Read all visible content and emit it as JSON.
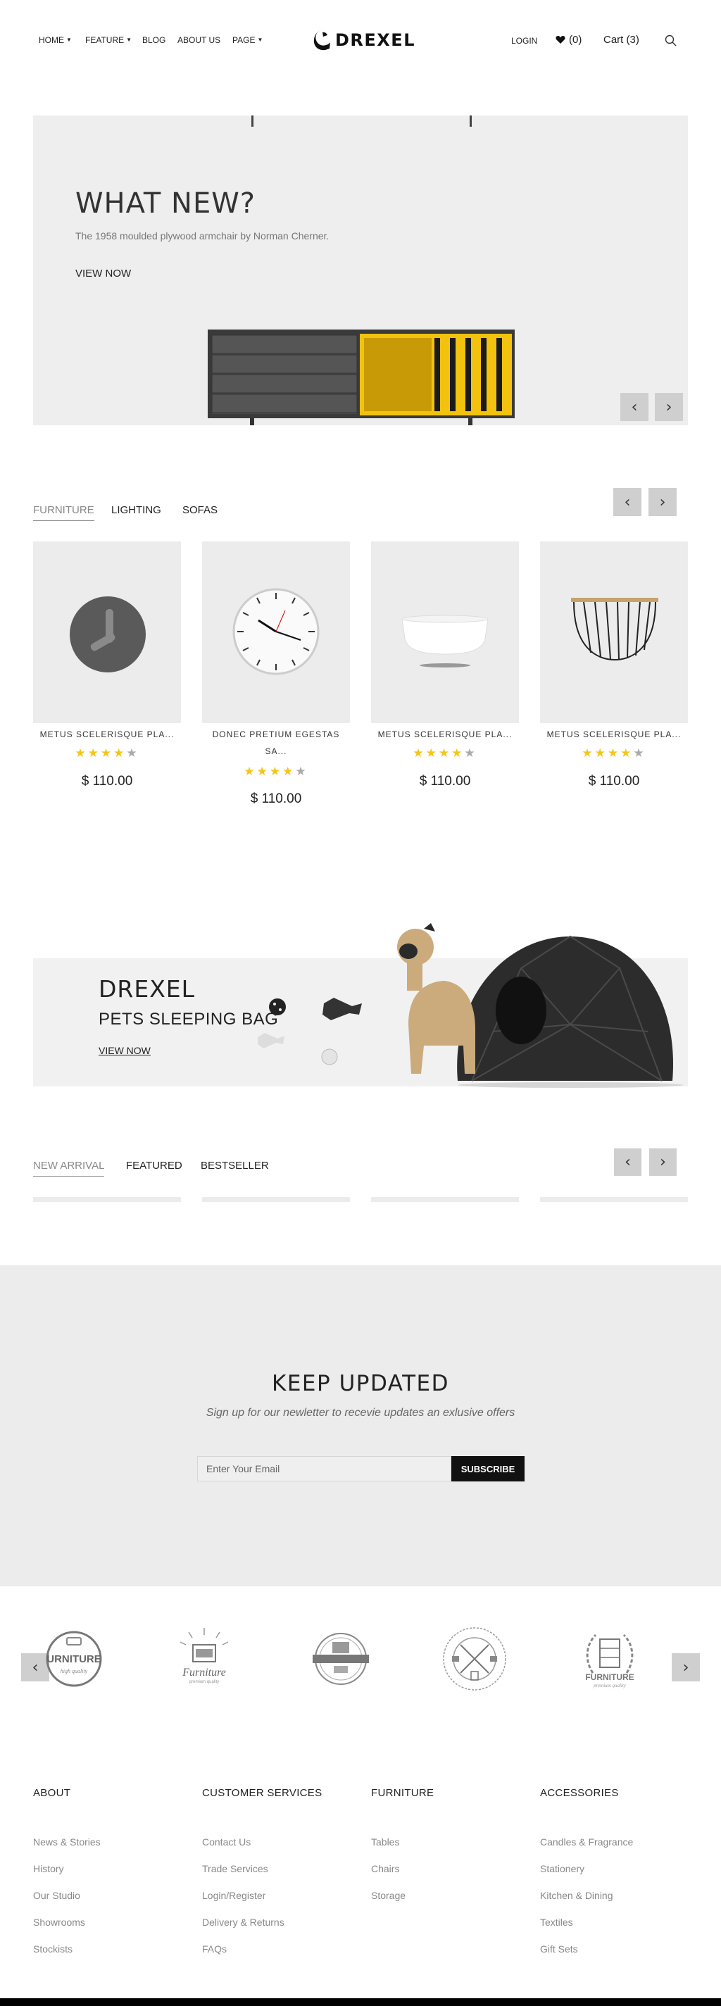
{
  "header": {
    "nav": [
      {
        "label": "HOME",
        "dropdown": true
      },
      {
        "label": "FEATURE",
        "dropdown": true
      },
      {
        "label": "BLOG",
        "dropdown": false
      },
      {
        "label": "ABOUT US",
        "dropdown": false
      },
      {
        "label": "PAGE",
        "dropdown": true
      }
    ],
    "logo_text": "DREXEL",
    "login_label": "LOGIN",
    "wishlist_count": "(0)",
    "cart_label": "Cart (3)",
    "icons": [
      "heart-icon",
      "search-icon",
      "chevron-down-icon"
    ]
  },
  "hero": {
    "title": "WHAT NEW?",
    "subtitle": "The 1958 moulded plywood armchair by Norman Cherner.",
    "link": "VIEW NOW",
    "prev": "‹",
    "next": "›"
  },
  "tabs1": {
    "items": [
      "FURNITURE",
      "LIGHTING",
      "SOFAS"
    ],
    "active": "FURNITURE"
  },
  "products": [
    {
      "name": "METUS SCELERISQUE PLA...",
      "rating": 4,
      "price": "$ 110.00",
      "image": "desk-clock"
    },
    {
      "name": "DONEC PRETIUM EGESTAS SA...",
      "rating": 4,
      "price": "$ 110.00",
      "image": "wall-clock"
    },
    {
      "name": "METUS SCELERISQUE PLA...",
      "rating": 4,
      "price": "$ 110.00",
      "image": "bowl"
    },
    {
      "name": "METUS SCELERISQUE PLA...",
      "rating": 4,
      "price": "$ 110.00",
      "image": "wire-basket"
    }
  ],
  "banner": {
    "brand": "DREXEL",
    "title": "PETS SLEEPING BAG",
    "link": "VIEW NOW"
  },
  "tabs2": {
    "items": [
      "NEW ARRIVAL",
      "FEATURED",
      "BESTSELLER"
    ],
    "active": "NEW ARRIVAL"
  },
  "newsletter": {
    "title": "KEEP UPDATED",
    "subtitle": "Sign up for our newletter to recevie updates an exlusive offers",
    "placeholder": "Enter Your Email",
    "button": "SUBSCRIBE"
  },
  "brands": [
    {
      "text": "URNITURE",
      "sub": "high quality"
    },
    {
      "text": "Furniture",
      "sub": "premium quality"
    },
    {
      "text": "",
      "sub": ""
    },
    {
      "text": "",
      "sub": ""
    },
    {
      "text": "FURNITURE",
      "sub": "premium quality"
    }
  ],
  "footer": {
    "columns": [
      {
        "heading": "ABOUT",
        "links": [
          "News & Stories",
          "History",
          "Our Studio",
          "Showrooms",
          "Stockists"
        ]
      },
      {
        "heading": "CUSTOMER SERVICES",
        "links": [
          "Contact Us",
          "Trade Services",
          "Login/Register",
          "Delivery & Returns",
          "FAQs"
        ]
      },
      {
        "heading": "FURNITURE",
        "links": [
          "Tables",
          "Chairs",
          "Storage"
        ]
      },
      {
        "heading": "ACCESSORIES",
        "links": [
          "Candles & Fragrance",
          "Stationery",
          "Kitchen & Dining",
          "Textiles",
          "Gift Sets"
        ]
      }
    ]
  },
  "colors": {
    "star": "#f5c518",
    "panel": "#eeeeee",
    "button_dark": "#111111"
  }
}
